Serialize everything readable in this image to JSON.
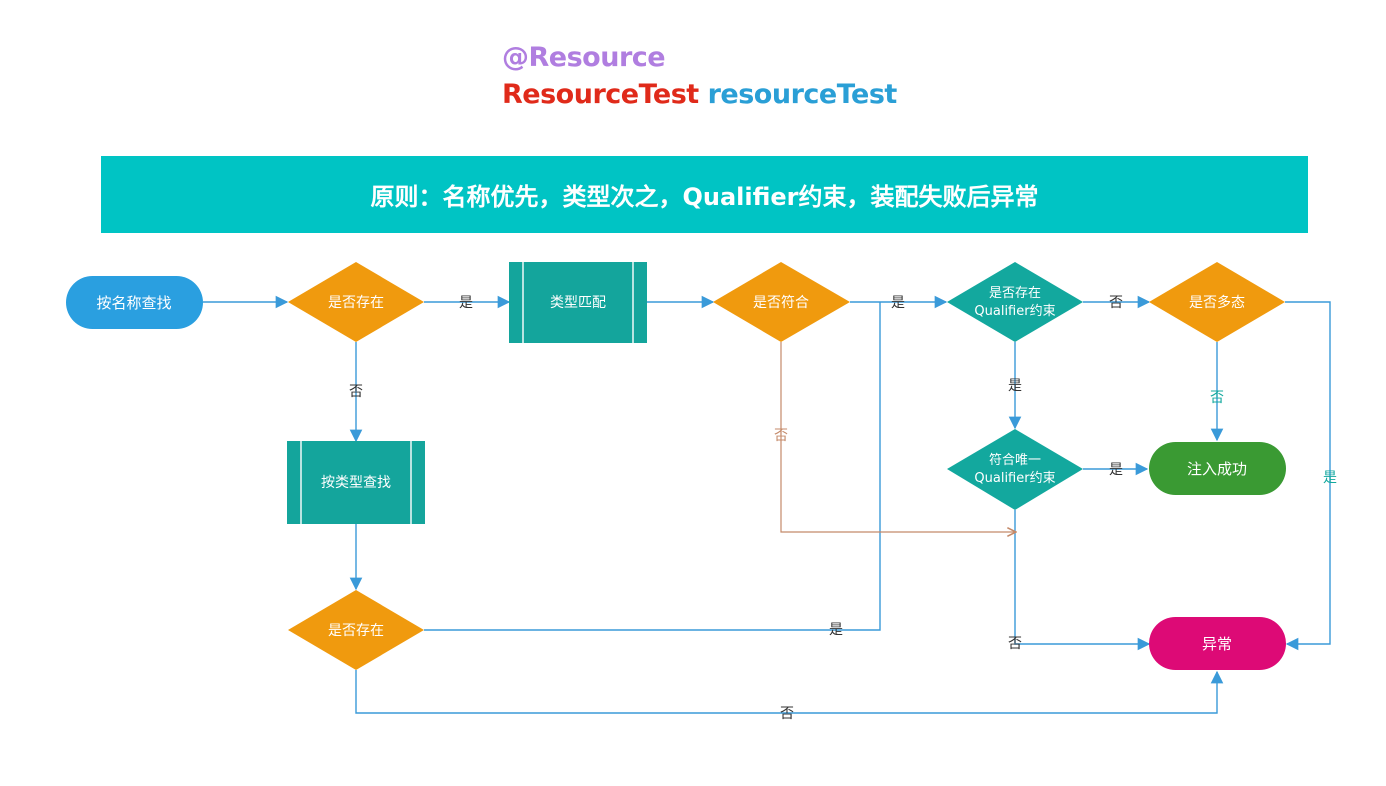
{
  "header": {
    "annotation": "@Resource",
    "class_name": "ResourceTest",
    "field_name": "resourceTest"
  },
  "banner": {
    "text": "原则：名称优先，类型次之，Qualifier约束，装配失败后异常"
  },
  "colors": {
    "annotation": "#b07ee0",
    "class_name": "#e02a1a",
    "field_name": "#2a9fd6",
    "banner": "#00c4c4",
    "start": "#2a9fe0",
    "decision_orange": "#f09a0e",
    "decision_teal": "#13a89e",
    "process": "#14a59c",
    "success": "#3a9a33",
    "error": "#dd0a76",
    "line_blue": "#3a9ad9",
    "line_brown": "#c48a6a"
  },
  "nodes": {
    "start": "按名称查找",
    "exists_by_name": "是否存在",
    "type_match": "类型匹配",
    "is_match": "是否符合",
    "has_qualifier": [
      "是否存在",
      "Qualifier约束"
    ],
    "is_polymorphic": "是否多态",
    "unique_qualifier": [
      "符合唯一",
      "Qualifier约束"
    ],
    "success": "注入成功",
    "find_by_type": "按类型查找",
    "exists_by_type": "是否存在",
    "error": "异常"
  },
  "edge_labels": {
    "exists_yes": "是",
    "exists_no": "否",
    "match_yes": "是",
    "match_no": "否",
    "qualifier_no": "否",
    "qualifier_yes": "是",
    "poly_no": "否",
    "poly_yes": "是",
    "unique_yes": "是",
    "unique_no": "否",
    "type_exists_yes": "是",
    "type_exists_no": "否"
  }
}
